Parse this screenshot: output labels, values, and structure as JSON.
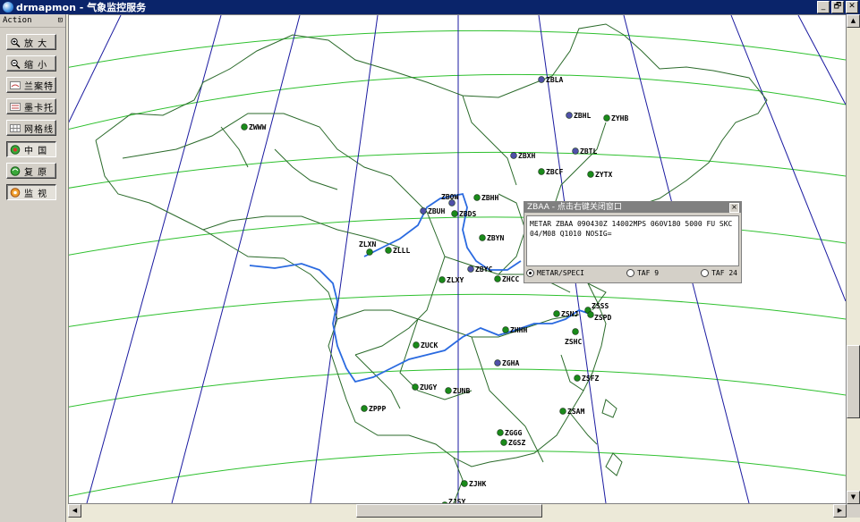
{
  "window": {
    "title": "drmapmon - 气象监控服务",
    "controls": [
      "_",
      "🗗",
      "✕"
    ]
  },
  "sidebar": {
    "header": "Action",
    "pin_glyph": "⊡",
    "buttons": [
      {
        "label": "放 大",
        "icon": "zoom-in-icon"
      },
      {
        "label": "缩 小",
        "icon": "zoom-out-icon"
      },
      {
        "label": "兰案特",
        "icon": "projection-icon"
      },
      {
        "label": "墨卡托",
        "icon": "mercator-icon"
      },
      {
        "label": "网格线",
        "icon": "grid-icon"
      },
      {
        "label": "中 国",
        "icon": "china-icon",
        "pressed": true
      },
      {
        "label": "复 原",
        "icon": "reset-icon"
      },
      {
        "label": "监 视",
        "icon": "monitor-icon",
        "pressed": true
      }
    ]
  },
  "popup": {
    "title": "ZBAA - 点击右键关闭窗口",
    "close": "×",
    "text": "METAR ZBAA 090430Z 14002MPS 060V180 5000 FU SKC\n04/M08 Q1010 NOSIG=",
    "radios": [
      {
        "label": "METAR/SPECI",
        "selected": true
      },
      {
        "label": "TAF 9",
        "selected": false
      },
      {
        "label": "TAF 24",
        "selected": false
      }
    ]
  },
  "stations": [
    {
      "code": "ZBLA",
      "type": "blue"
    },
    {
      "code": "ZWWW",
      "type": "green"
    },
    {
      "code": "ZYHB",
      "type": "green"
    },
    {
      "code": "ZBHL",
      "type": "blue"
    },
    {
      "code": "ZBXH",
      "type": "blue"
    },
    {
      "code": "ZBTL",
      "type": "blue"
    },
    {
      "code": "ZBCF",
      "type": "green"
    },
    {
      "code": "ZYTX",
      "type": "green"
    },
    {
      "code": "ZBOW",
      "type": "blue"
    },
    {
      "code": "ZBHH",
      "type": "green"
    },
    {
      "code": "ZBUH",
      "type": "blue"
    },
    {
      "code": "ZBDS",
      "type": "green"
    },
    {
      "code": "ZBYN",
      "type": "green"
    },
    {
      "code": "ZBYC",
      "type": "blue"
    },
    {
      "code": "ZLXN",
      "type": "green"
    },
    {
      "code": "ZLLL",
      "type": "green"
    },
    {
      "code": "ZLXY",
      "type": "green"
    },
    {
      "code": "ZHCC",
      "type": "green"
    },
    {
      "code": "ZSNJ",
      "type": "green"
    },
    {
      "code": "ZSSS",
      "type": "green"
    },
    {
      "code": "ZSPD",
      "type": "green"
    },
    {
      "code": "ZUCK",
      "type": "green"
    },
    {
      "code": "ZHHH",
      "type": "green"
    },
    {
      "code": "ZSHC",
      "type": "green"
    },
    {
      "code": "ZGHA",
      "type": "blue"
    },
    {
      "code": "ZUGY",
      "type": "green"
    },
    {
      "code": "ZUNB",
      "type": "green"
    },
    {
      "code": "ZSFZ",
      "type": "green"
    },
    {
      "code": "ZPPP",
      "type": "green"
    },
    {
      "code": "ZSAM",
      "type": "green"
    },
    {
      "code": "ZGGG",
      "type": "green"
    },
    {
      "code": "ZGSZ",
      "type": "green"
    },
    {
      "code": "ZJHK",
      "type": "green"
    },
    {
      "code": "ZJSY",
      "type": "green"
    }
  ],
  "colors": {
    "green_station": "#1a8a1a",
    "blue_station": "#5050a8",
    "gridline_green": "#2ec02e",
    "meridian_blue": "#1a1aa0",
    "border_green": "#2a6a2a",
    "river_blue": "#2a6ae0"
  }
}
